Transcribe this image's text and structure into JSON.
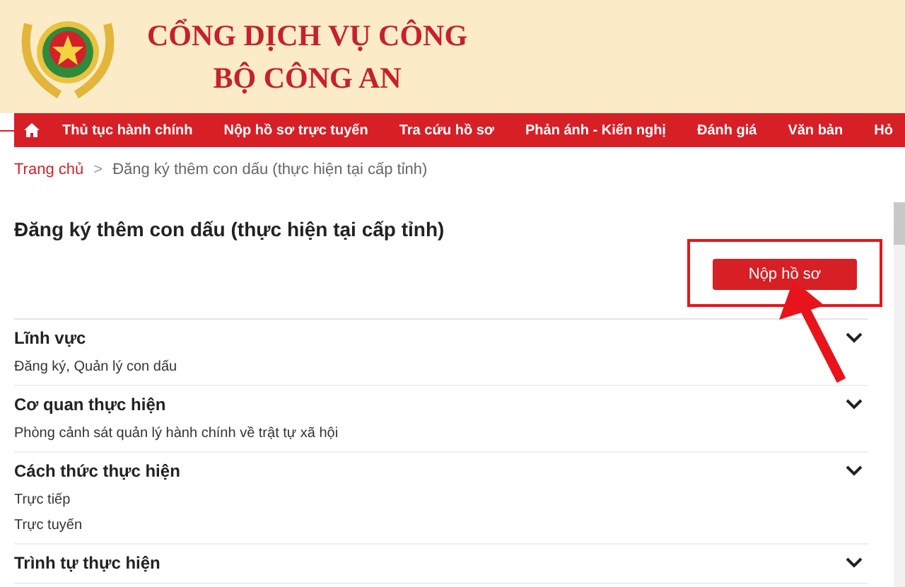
{
  "header": {
    "title_line_1": "CỔNG DỊCH VỤ CÔNG",
    "title_line_2": "BỘ CÔNG AN"
  },
  "nav": {
    "items": [
      {
        "label": "Thủ tục hành chính"
      },
      {
        "label": "Nộp hồ sơ trực tuyến"
      },
      {
        "label": "Tra cứu hồ sơ"
      },
      {
        "label": "Phản ánh - Kiến nghị"
      },
      {
        "label": "Đánh giá"
      },
      {
        "label": "Văn bản"
      },
      {
        "label": "Hỏ"
      }
    ]
  },
  "breadcrumb": {
    "home": "Trang chủ",
    "separator": ">",
    "current": "Đăng ký thêm con dấu (thực hiện tại cấp tỉnh)"
  },
  "page_title": "Đăng ký thêm con dấu (thực hiện tại cấp tỉnh)",
  "submit_button": "Nộp hồ sơ",
  "sections": [
    {
      "title": "Lĩnh vực",
      "lines": [
        "Đăng ký, Quản lý con dấu"
      ]
    },
    {
      "title": "Cơ quan thực hiện",
      "lines": [
        "Phòng cảnh sát quản lý hành chính về trật tự xã hội"
      ]
    },
    {
      "title": "Cách thức thực hiện",
      "lines": [
        "Trực tiếp",
        "Trực tuyến"
      ]
    },
    {
      "title": "Trình tự thực hiện"
    }
  ]
}
